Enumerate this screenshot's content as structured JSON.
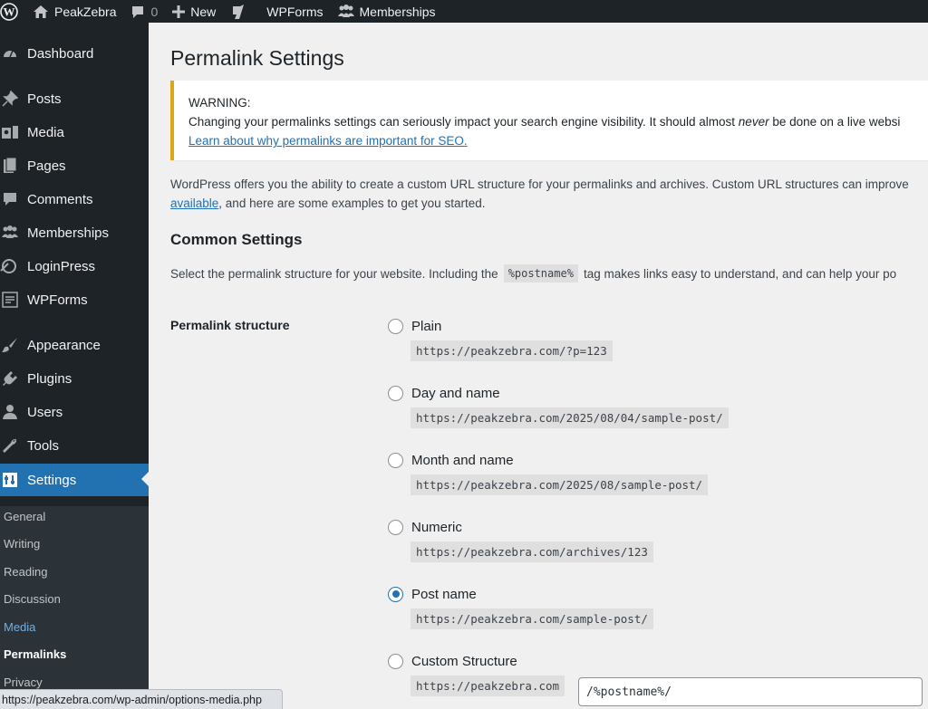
{
  "adminbar": {
    "site_name": "PeakZebra",
    "comments_count": "0",
    "new_label": "New",
    "wpforms_label": "WPForms",
    "memberships_label": "Memberships"
  },
  "sidebar": {
    "items": [
      {
        "label": "Dashboard",
        "icon": "dashboard-icon"
      },
      {
        "label": "Posts",
        "icon": "pin-icon"
      },
      {
        "label": "Media",
        "icon": "media-icon"
      },
      {
        "label": "Pages",
        "icon": "pages-icon"
      },
      {
        "label": "Comments",
        "icon": "comment-icon"
      },
      {
        "label": "Memberships",
        "icon": "groups-icon"
      },
      {
        "label": "LoginPress",
        "icon": "loginpress-icon"
      },
      {
        "label": "WPForms",
        "icon": "form-icon"
      },
      {
        "label": "Appearance",
        "icon": "brush-icon"
      },
      {
        "label": "Plugins",
        "icon": "plugin-icon"
      },
      {
        "label": "Users",
        "icon": "user-icon"
      },
      {
        "label": "Tools",
        "icon": "wrench-icon"
      },
      {
        "label": "Settings",
        "icon": "settings-icon"
      }
    ],
    "submenu": [
      "General",
      "Writing",
      "Reading",
      "Discussion",
      "Media",
      "Permalinks",
      "Privacy"
    ]
  },
  "page": {
    "title": "Permalink Settings",
    "warning_title": "WARNING:",
    "warning_text_before": "Changing your permalinks settings can seriously impact your search engine visibility. It should almost ",
    "warning_text_em": "never",
    "warning_text_after": " be done on a live websi",
    "warning_link": "Learn about why permalinks are important for SEO.",
    "intro_line1": "WordPress offers you the ability to create a custom URL structure for your permalinks and archives. Custom URL structures can improve",
    "intro_link": "available",
    "intro_line2_rest": ", and here are some examples to get you started.",
    "section_title": "Common Settings",
    "select_before": "Select the permalink structure for your website. Including the",
    "select_code": "%postname%",
    "select_after": "tag makes links easy to understand, and can help your po",
    "structure_label": "Permalink structure"
  },
  "options": [
    {
      "label": "Plain",
      "example": "https://peakzebra.com/?p=123",
      "checked": false
    },
    {
      "label": "Day and name",
      "example": "https://peakzebra.com/2025/08/04/sample-post/",
      "checked": false
    },
    {
      "label": "Month and name",
      "example": "https://peakzebra.com/2025/08/sample-post/",
      "checked": false
    },
    {
      "label": "Numeric",
      "example": "https://peakzebra.com/archives/123",
      "checked": false
    },
    {
      "label": "Post name",
      "example": "https://peakzebra.com/sample-post/",
      "checked": true
    },
    {
      "label": "Custom Structure",
      "example": "https://peakzebra.com",
      "checked": false
    }
  ],
  "custom_structure_value": "/%postname%/",
  "status_url": "https://peakzebra.com/wp-admin/options-media.php",
  "colors": {
    "accent": "#2271b1",
    "admin_dark": "#1d2327",
    "warning": "#dba617"
  }
}
